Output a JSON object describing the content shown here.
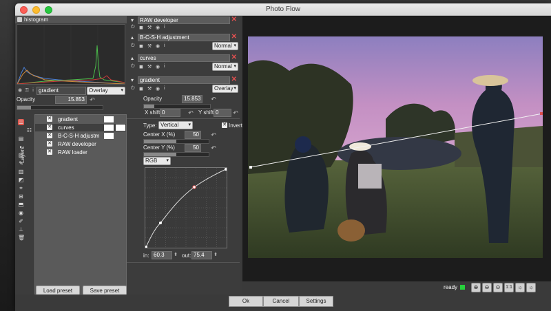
{
  "window": {
    "title": "Photo Flow"
  },
  "histogram": {
    "label": "histogram"
  },
  "layer_props": {
    "name": "gradient",
    "blend": "Overlay",
    "opacity_label": "Opacity",
    "opacity_value": "15.853"
  },
  "layers_tab": "Layers",
  "layers": [
    {
      "name": "gradient"
    },
    {
      "name": "curves"
    },
    {
      "name": "B-C-S-H adjustm"
    },
    {
      "name": "RAW developer"
    },
    {
      "name": "RAW loader"
    }
  ],
  "buttons": {
    "load_preset": "Load preset",
    "save_preset": "Save preset"
  },
  "modules": {
    "raw_developer": {
      "title": "RAW developer"
    },
    "bcsh": {
      "title": "B-C-S-H adjustment",
      "blend": "Normal"
    },
    "curves": {
      "title": "curves",
      "blend": "Normal"
    },
    "gradient": {
      "title": "gradient",
      "blend": "Overlay",
      "opacity_label": "Opacity",
      "opacity_value": "15.853",
      "xshift_label": "X shift",
      "xshift_value": "0",
      "yshift_label": "Y shift",
      "yshift_value": "0"
    }
  },
  "gradient_settings": {
    "type_label": "Type:",
    "type_value": "Vertical",
    "invert_label": "Invert",
    "centerx_label": "Center X (%)",
    "centerx_value": "50",
    "centery_label": "Center Y (%)",
    "centery_value": "50",
    "channel": "RGB",
    "in_label": "in:",
    "in_value": "60.3",
    "out_label": "out:",
    "out_value": "75.4"
  },
  "status": {
    "text": "ready",
    "zoom_buttons": [
      "⊕",
      "⊖",
      "⊙",
      "1:1",
      "☼",
      "☼"
    ]
  },
  "bottom_buttons": {
    "ok": "Ok",
    "cancel": "Cancel",
    "settings": "Settings"
  },
  "colors": {
    "accent_red": "#e05050",
    "ready_green": "#27d13c"
  }
}
